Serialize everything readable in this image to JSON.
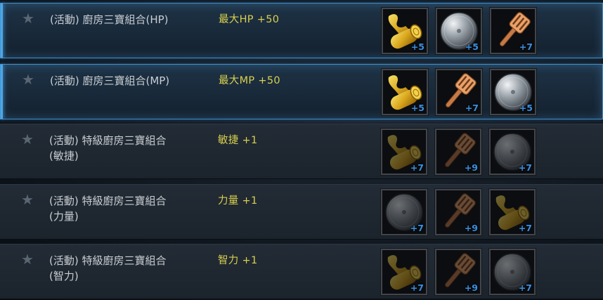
{
  "rows": [
    {
      "name_line1": "(活動) 廚房三寶組合(HP)",
      "name_line2": "",
      "effect": "最大HP +50",
      "active": true,
      "items": [
        {
          "icon": "gold-roll-icon",
          "enhance": "+5"
        },
        {
          "icon": "shield-icon",
          "enhance": "+5"
        },
        {
          "icon": "spatula-icon",
          "enhance": "+7"
        }
      ]
    },
    {
      "name_line1": "(活動) 廚房三寶組合(MP)",
      "name_line2": "",
      "effect": "最大MP +50",
      "active": true,
      "items": [
        {
          "icon": "gold-roll-icon",
          "enhance": "+5"
        },
        {
          "icon": "spatula-icon",
          "enhance": "+7"
        },
        {
          "icon": "shield-icon",
          "enhance": "+5"
        }
      ]
    },
    {
      "name_line1": "(活動) 特級廚房三寶組合",
      "name_line2": "(敏捷)",
      "effect": "敏捷 +1",
      "active": false,
      "items": [
        {
          "icon": "gold-roll-icon",
          "enhance": "+7"
        },
        {
          "icon": "spatula-icon",
          "enhance": "+9"
        },
        {
          "icon": "shield-icon",
          "enhance": "+7"
        }
      ]
    },
    {
      "name_line1": "(活動) 特級廚房三寶組合",
      "name_line2": "(力量)",
      "effect": "力量 +1",
      "active": false,
      "items": [
        {
          "icon": "shield-icon",
          "enhance": "+7"
        },
        {
          "icon": "spatula-icon",
          "enhance": "+9"
        },
        {
          "icon": "gold-roll-icon",
          "enhance": "+7"
        }
      ]
    },
    {
      "name_line1": "(活動) 特級廚房三寶組合",
      "name_line2": "(智力)",
      "effect": "智力 +1",
      "active": false,
      "items": [
        {
          "icon": "gold-roll-icon",
          "enhance": "+7"
        },
        {
          "icon": "spatula-icon",
          "enhance": "+9"
        },
        {
          "icon": "shield-icon",
          "enhance": "+7"
        }
      ]
    }
  ],
  "colors": {
    "effect_text": "#d9cf4e",
    "enhance_text": "#3b8fe0",
    "active_border": "#3f8fc9"
  }
}
